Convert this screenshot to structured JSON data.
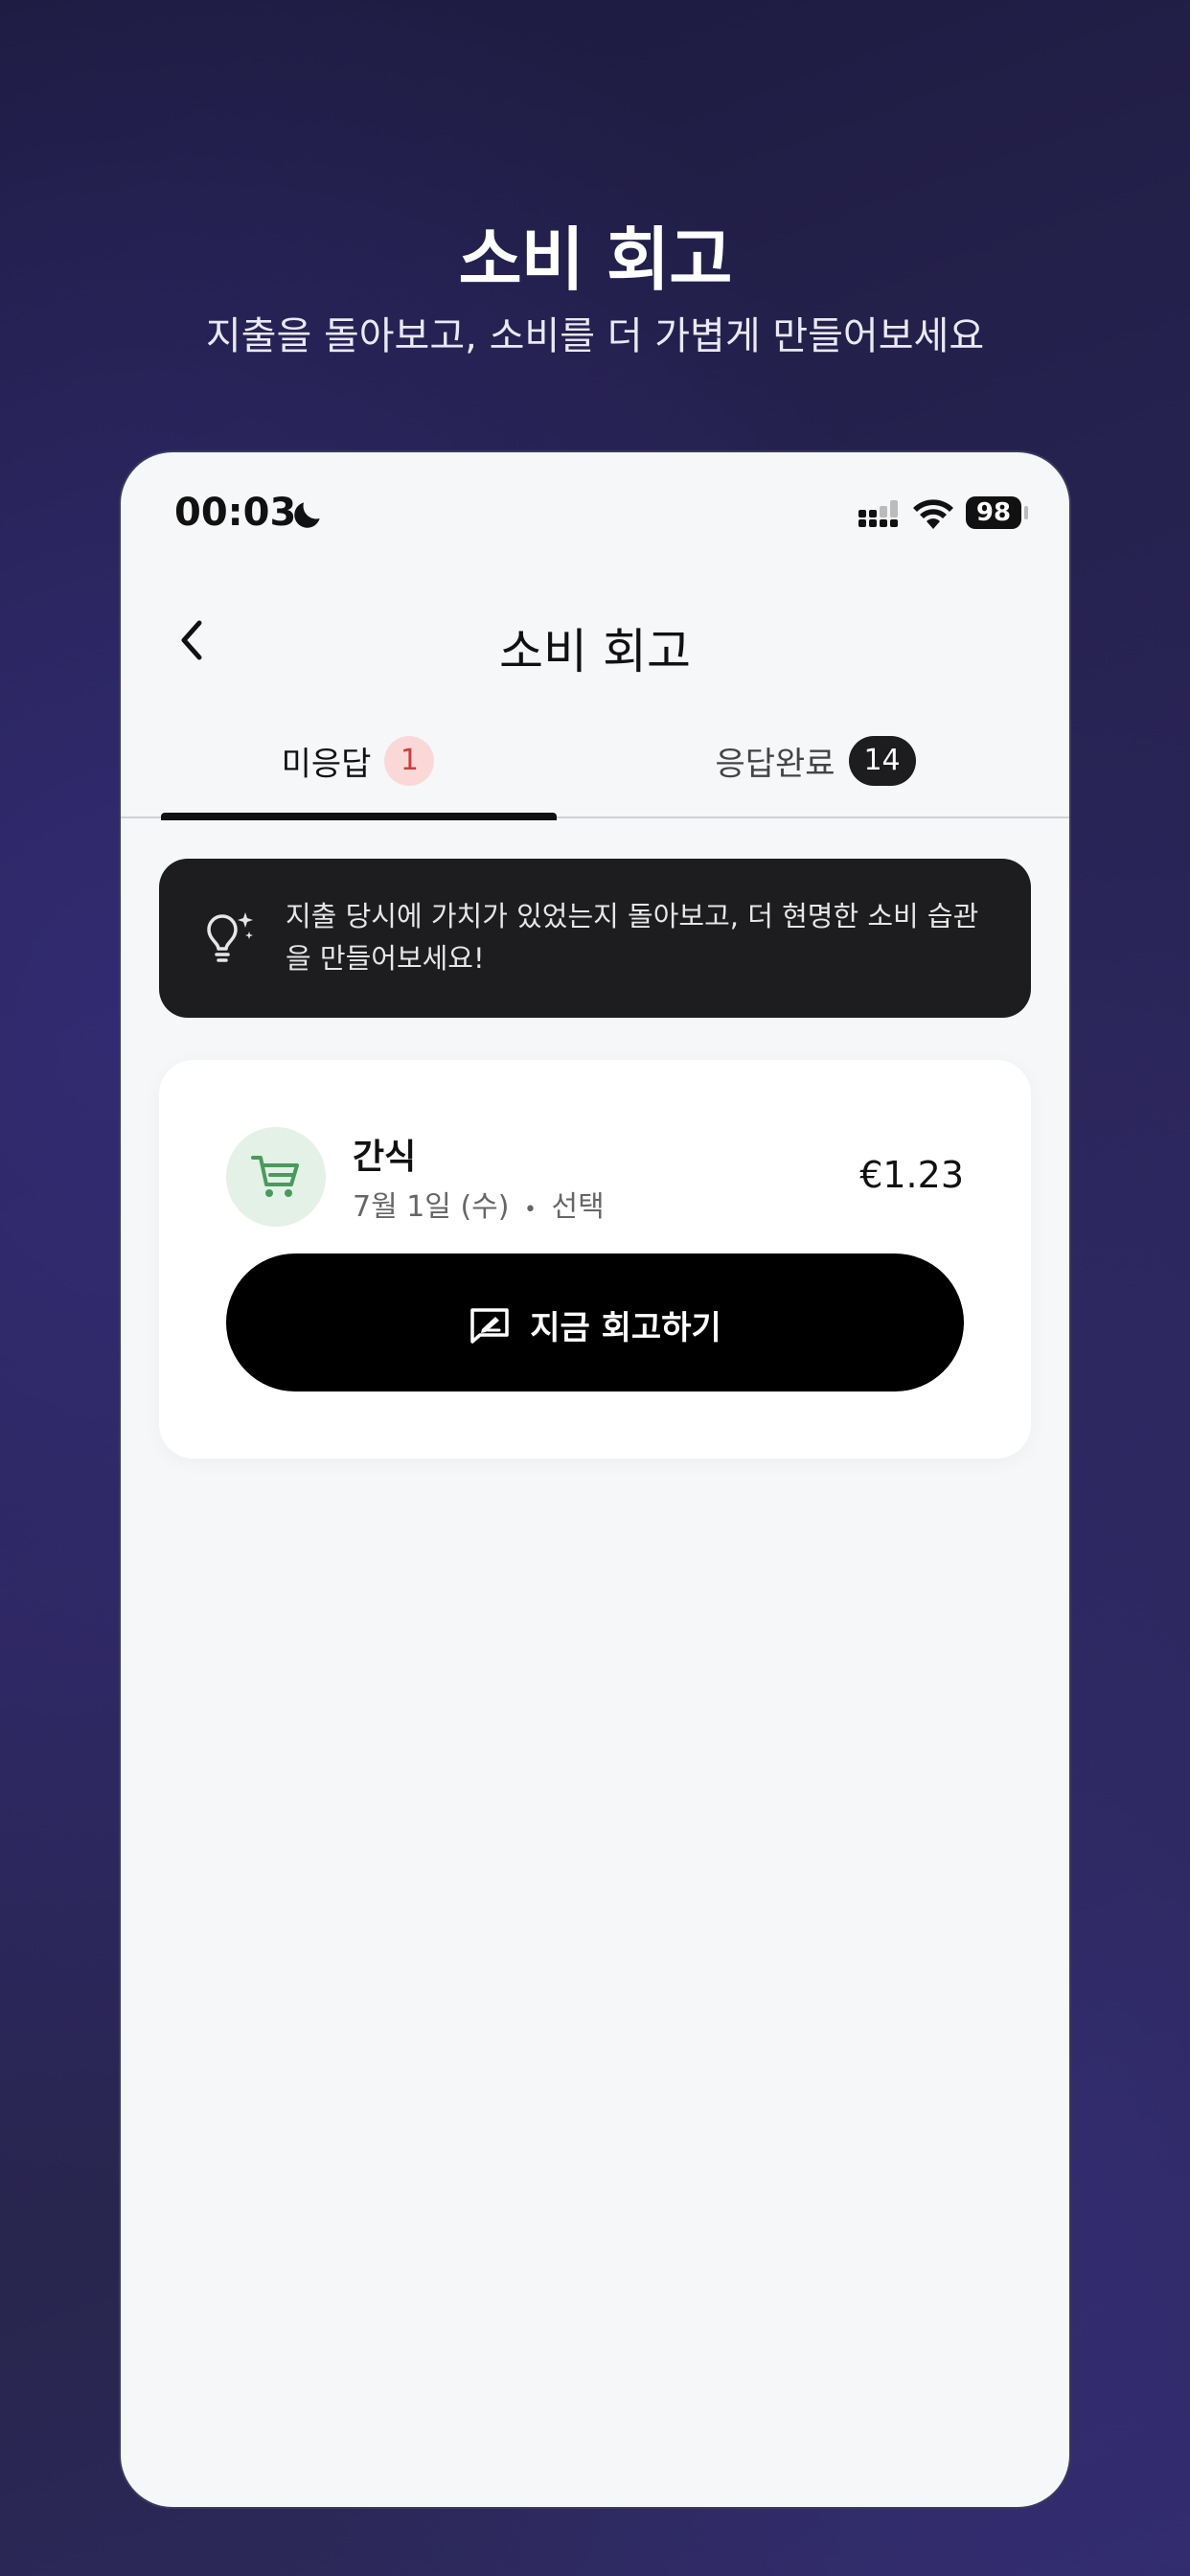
{
  "hero": {
    "title": "소비 회고",
    "subtitle": "지출을 돌아보고, 소비를 더 가볍게 만들어보세요"
  },
  "status_bar": {
    "time": "00:03",
    "battery": "98",
    "icons": [
      "moon-icon",
      "signal-icon",
      "wifi-icon",
      "battery-icon"
    ]
  },
  "nav": {
    "title": "소비 회고",
    "back_icon": "chevron-left-icon"
  },
  "tabs": [
    {
      "label": "미응답",
      "count": "1",
      "selected": true,
      "badge_color": "#fbd8d8"
    },
    {
      "label": "응답완료",
      "count": "14",
      "selected": false,
      "badge_color": "#1d1d1f"
    }
  ],
  "tip": {
    "icon": "lightbulb-sparkle-icon",
    "text": "지출 당시에 가치가 있었는지 돌아보고, 더 현명한 소비 습관을 만들어보세요!"
  },
  "items": [
    {
      "category_icon": "cart-icon",
      "title": "간식",
      "date": "7월 1일 (수)",
      "separator": "•",
      "tag": "선택",
      "amount": "€1.23",
      "action_label": "지금 회고하기",
      "action_icon": "chat-edit-icon"
    }
  ],
  "colors": {
    "accent_green": "#4a9a5e",
    "badge_pink": "#fbd8d8",
    "dark": "#1d1d1f"
  }
}
